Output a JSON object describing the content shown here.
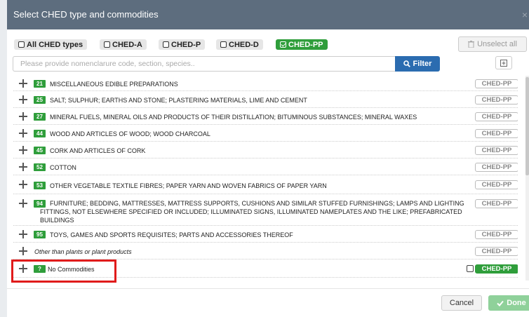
{
  "header": {
    "title": "Select CHED type and commodities",
    "close": "×"
  },
  "ched_types": [
    {
      "label": "All CHED types",
      "active": false
    },
    {
      "label": "CHED-A",
      "active": false
    },
    {
      "label": "CHED-P",
      "active": false
    },
    {
      "label": "CHED-D",
      "active": false
    },
    {
      "label": "CHED-PP",
      "active": true
    }
  ],
  "unselect_label": "Unselect all",
  "search": {
    "placeholder": "Please provide nomenclarure code, section, species.."
  },
  "filter_label": "Filter",
  "rows": [
    {
      "code": "21",
      "text": "MISCELLANEOUS EDIBLE PREPARATIONS",
      "tag": "CHED-PP"
    },
    {
      "code": "25",
      "text": "SALT; SULPHUR; EARTHS AND STONE; PLASTERING MATERIALS, LIME AND CEMENT",
      "tag": "CHED-PP"
    },
    {
      "code": "27",
      "text": "MINERAL FUELS, MINERAL OILS AND PRODUCTS OF THEIR DISTILLATION; BITUMINOUS SUBSTANCES; MINERAL WAXES",
      "tag": "CHED-PP"
    },
    {
      "code": "44",
      "text": "WOOD AND ARTICLES OF WOOD; WOOD CHARCOAL",
      "tag": "CHED-PP"
    },
    {
      "code": "45",
      "text": "CORK AND ARTICLES OF CORK",
      "tag": "CHED-PP"
    },
    {
      "code": "52",
      "text": "COTTON",
      "tag": "CHED-PP"
    },
    {
      "code": "53",
      "text": "OTHER VEGETABLE TEXTILE FIBRES; PAPER YARN AND WOVEN FABRICS OF PAPER YARN",
      "tag": "CHED-PP"
    },
    {
      "code": "94",
      "text": "FURNITURE; BEDDING, MATTRESSES, MATTRESS SUPPORTS, CUSHIONS AND SIMILAR STUFFED FURNISHINGS; LAMPS AND LIGHTING FITTINGS, NOT ELSEWHERE SPECIFIED OR INCLUDED; ILLUMINATED SIGNS, ILLUMINATED NAMEPLATES AND THE LIKE; PREFABRICATED BUILDINGS",
      "tag": "CHED-PP"
    },
    {
      "code": "95",
      "text": "TOYS, GAMES AND SPORTS REQUISITES; PARTS AND ACCESSORIES THEREOF",
      "tag": "CHED-PP"
    },
    {
      "code": "",
      "text": "Other than plants or plant products",
      "tag": "CHED-PP"
    },
    {
      "code": "?",
      "text": "No Commodities",
      "tag": "CHED-PP"
    }
  ],
  "footer": {
    "cancel": "Cancel",
    "done": "Done"
  },
  "colors": {
    "header": "#5d6d7e",
    "green": "#2f9e3b",
    "blue": "#2b6cb0",
    "highlight": "#e01b1b"
  }
}
